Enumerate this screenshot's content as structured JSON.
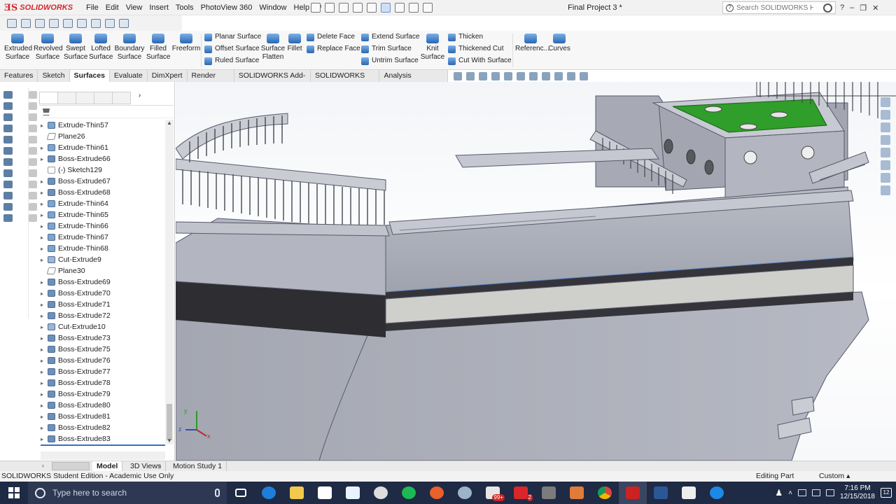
{
  "app": {
    "logo_text": "SOLIDWORKS",
    "doc_title": "Final Project 3 *"
  },
  "menu": [
    "File",
    "Edit",
    "View",
    "Insert",
    "Tools",
    "PhotoView 360",
    "Window",
    "Help"
  ],
  "search": {
    "placeholder": "Search SOLIDWORKS Help"
  },
  "window_controls": {
    "help": "?",
    "minimize": "–",
    "restore": "❐",
    "close": "✕"
  },
  "ribbon": {
    "big_buttons": [
      {
        "line1": "Extruded",
        "line2": "Surface",
        "icon": "extruded-surface-icon"
      },
      {
        "line1": "Revolved",
        "line2": "Surface",
        "icon": "revolved-surface-icon"
      },
      {
        "line1": "Swept",
        "line2": "Surface",
        "icon": "swept-surface-icon"
      },
      {
        "line1": "Lofted",
        "line2": "Surface",
        "icon": "lofted-surface-icon"
      },
      {
        "line1": "Boundary",
        "line2": "Surface",
        "icon": "boundary-surface-icon"
      },
      {
        "line1": "Filled",
        "line2": "Surface",
        "icon": "filled-surface-icon"
      },
      {
        "line1": "Freeform",
        "line2": "",
        "icon": "freeform-icon"
      }
    ],
    "col1": [
      "Planar Surface",
      "Offset Surface",
      "Ruled Surface"
    ],
    "surface_flatten": {
      "line1": "Surface",
      "line2": "Flatten"
    },
    "fillet": "Fillet",
    "col2": [
      "Delete Face",
      "Replace Face"
    ],
    "col3": [
      "Extend Surface",
      "Trim Surface",
      "Untrim Surface"
    ],
    "knit": {
      "line1": "Knit",
      "line2": "Surface"
    },
    "col4": [
      "Thicken",
      "Thickened Cut",
      "Cut With Surface"
    ],
    "reference": "Referenc...",
    "curves": "Curves"
  },
  "tabs": [
    {
      "label": "Features",
      "active": false
    },
    {
      "label": "Sketch",
      "active": false
    },
    {
      "label": "Surfaces",
      "active": true
    },
    {
      "label": "Evaluate",
      "active": false
    },
    {
      "label": "DimXpert",
      "active": false
    },
    {
      "label": "Render Tools",
      "active": false
    },
    {
      "label": "SOLIDWORKS Add-Ins",
      "active": false
    },
    {
      "label": "SOLIDWORKS MBD",
      "active": false
    },
    {
      "label": "Analysis Preparation",
      "active": false
    }
  ],
  "tree": [
    {
      "label": "Extrude-Thin57",
      "type": "thin",
      "expand": true
    },
    {
      "label": "Plane26",
      "type": "plane",
      "expand": false
    },
    {
      "label": "Extrude-Thin61",
      "type": "thin",
      "expand": true
    },
    {
      "label": "Boss-Extrude66",
      "type": "boss",
      "expand": true
    },
    {
      "label": "(-) Sketch129",
      "type": "sketch",
      "expand": false
    },
    {
      "label": "Boss-Extrude67",
      "type": "boss",
      "expand": true
    },
    {
      "label": "Boss-Extrude68",
      "type": "boss",
      "expand": true
    },
    {
      "label": "Extrude-Thin64",
      "type": "thin",
      "expand": true
    },
    {
      "label": "Extrude-Thin65",
      "type": "thin",
      "expand": true
    },
    {
      "label": "Extrude-Thin66",
      "type": "thin",
      "expand": true
    },
    {
      "label": "Extrude-Thin67",
      "type": "thin",
      "expand": true
    },
    {
      "label": "Extrude-Thin68",
      "type": "thin",
      "expand": true
    },
    {
      "label": "Cut-Extrude9",
      "type": "cut",
      "expand": true
    },
    {
      "label": "Plane30",
      "type": "plane",
      "expand": false
    },
    {
      "label": "Boss-Extrude69",
      "type": "boss",
      "expand": true
    },
    {
      "label": "Boss-Extrude70",
      "type": "boss",
      "expand": true
    },
    {
      "label": "Boss-Extrude71",
      "type": "boss",
      "expand": true
    },
    {
      "label": "Boss-Extrude72",
      "type": "boss",
      "expand": true
    },
    {
      "label": "Cut-Extrude10",
      "type": "cut",
      "expand": true
    },
    {
      "label": "Boss-Extrude73",
      "type": "boss",
      "expand": true
    },
    {
      "label": "Boss-Extrude75",
      "type": "boss",
      "expand": true
    },
    {
      "label": "Boss-Extrude76",
      "type": "boss",
      "expand": true
    },
    {
      "label": "Boss-Extrude77",
      "type": "boss",
      "expand": true
    },
    {
      "label": "Boss-Extrude78",
      "type": "boss",
      "expand": true
    },
    {
      "label": "Boss-Extrude79",
      "type": "boss",
      "expand": true
    },
    {
      "label": "Boss-Extrude80",
      "type": "boss",
      "expand": true
    },
    {
      "label": "Boss-Extrude81",
      "type": "boss",
      "expand": true
    },
    {
      "label": "Boss-Extrude82",
      "type": "boss",
      "expand": true
    },
    {
      "label": "Boss-Extrude83",
      "type": "boss",
      "expand": true
    }
  ],
  "bottom_tabs": [
    {
      "label": "Model",
      "active": true
    },
    {
      "label": "3D Views",
      "active": false
    },
    {
      "label": "Motion Study 1",
      "active": false
    }
  ],
  "status": {
    "left": "SOLIDWORKS Student Edition - Academic Use Only",
    "mode": "Editing Part",
    "units": "Custom"
  },
  "triad": {
    "x": "x",
    "y": "y",
    "z": "z"
  },
  "taskbar": {
    "search_placeholder": "Type here to search",
    "time": "7:16 PM",
    "date": "12/15/2018",
    "notifications": "12",
    "badge_mail": "99+",
    "badge_app": "2"
  },
  "colors": {
    "accent": "#d9262a",
    "deck_green": "#2f9e2a",
    "hull": "#a6a9b2",
    "taskbar": "#1f2a44"
  }
}
